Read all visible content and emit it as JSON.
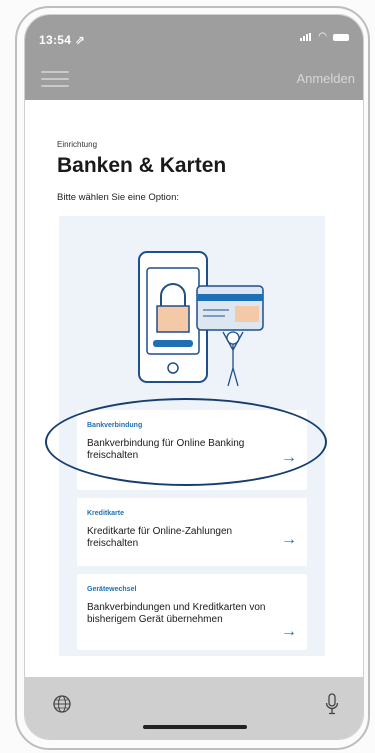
{
  "status": {
    "time": "13:54 ⇗"
  },
  "header": {
    "login_label": "Anmelden"
  },
  "main": {
    "eyebrow": "Einrichtung",
    "title": "Banken & Karten",
    "subtitle": "Bitte wählen Sie eine Option:"
  },
  "options": [
    {
      "category": "Bankverbindung",
      "description": "Bankverbindung für Online Banking freischalten",
      "arrow": "→"
    },
    {
      "category": "Kreditkarte",
      "description": "Kreditkarte für Online-Zahlungen freischalten",
      "arrow": "→"
    },
    {
      "category": "Gerätewechsel",
      "description": "Bankverbindungen und Kreditkarten von bisherigem Gerät übernehmen",
      "arrow": "→"
    }
  ],
  "colors": {
    "accent": "#1f6fb5",
    "header_bg": "#9e9e9e",
    "panel_bg": "#eef3f9",
    "highlight": "#153d70"
  },
  "icons": [
    "hamburger-menu-icon",
    "globe-icon",
    "microphone-icon",
    "lock-icon",
    "credit-card-icon"
  ]
}
